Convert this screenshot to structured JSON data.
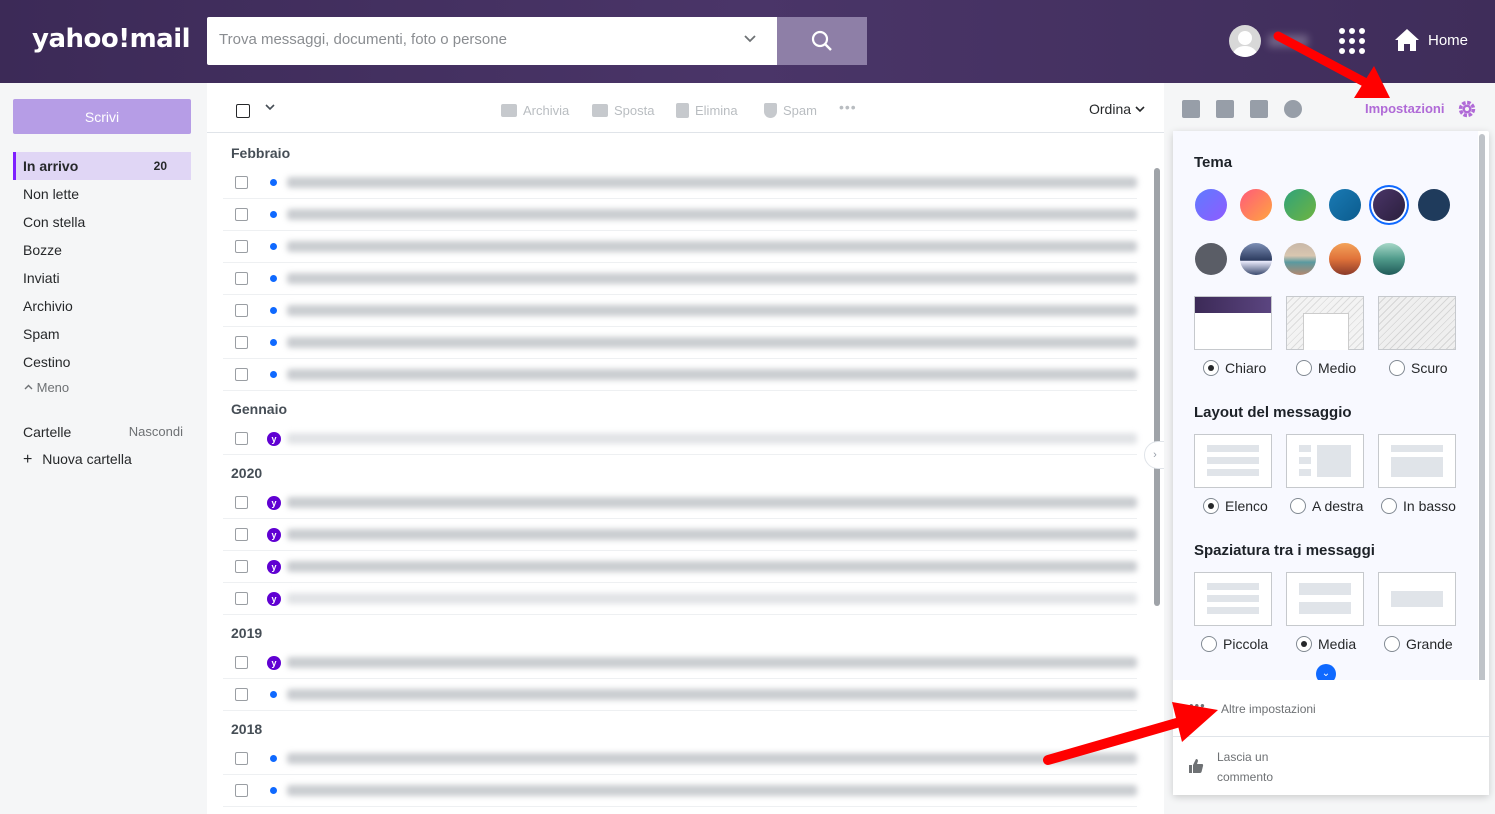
{
  "header": {
    "logo": "yahoo!mail",
    "search_placeholder": "Trova messaggi, documenti, foto o persone",
    "home_label": "Home"
  },
  "sidebar": {
    "compose_label": "Scrivi",
    "items": [
      {
        "label": "In arrivo",
        "count": "20"
      },
      {
        "label": "Non lette"
      },
      {
        "label": "Con stella"
      },
      {
        "label": "Bozze"
      },
      {
        "label": "Inviati"
      },
      {
        "label": "Archivio"
      },
      {
        "label": "Spam"
      },
      {
        "label": "Cestino"
      }
    ],
    "less_label": "Meno",
    "folders_label": "Cartelle",
    "hide_label": "Nascondi",
    "new_folder_label": "Nuova cartella"
  },
  "toolbar": {
    "archive": "Archivia",
    "move": "Sposta",
    "delete": "Elimina",
    "spam": "Spam",
    "more": "•••",
    "sort": "Ordina"
  },
  "groups": [
    "Febbraio",
    "Gennaio",
    "2020",
    "2019",
    "2018"
  ],
  "rail": {
    "settings_label": "Impostazioni"
  },
  "settings": {
    "theme_title": "Tema",
    "theme_modes": [
      "Chiaro",
      "Medio",
      "Scuro"
    ],
    "layout_title": "Layout del messaggio",
    "layout_options": [
      "Elenco",
      "A destra",
      "In basso"
    ],
    "spacing_title": "Spaziatura tra i messaggi",
    "spacing_options": [
      "Piccola",
      "Media",
      "Grande"
    ],
    "more_settings": "Altre impostazioni",
    "feedback_line1": "Lascia un",
    "feedback_line2": "commento",
    "colors": {
      "accent": "#b06ad7",
      "selected_ring": "#0f69ff",
      "brand": "#6001d2"
    }
  }
}
